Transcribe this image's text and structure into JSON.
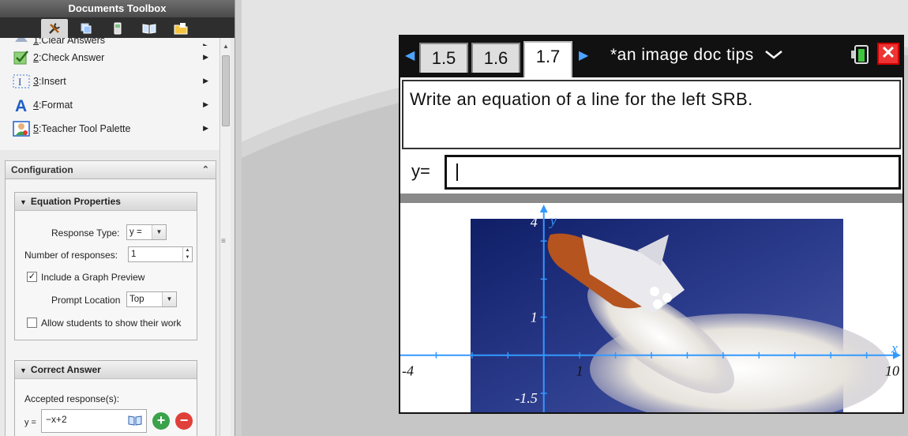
{
  "toolbox": {
    "title": "Documents Toolbox",
    "menu": [
      {
        "num": "1",
        "label": ":Clear Answers"
      },
      {
        "num": "2",
        "label": ":Check Answer"
      },
      {
        "num": "3",
        "label": ":Insert"
      },
      {
        "num": "4",
        "label": ":Format"
      },
      {
        "num": "5",
        "label": ":Teacher Tool Palette"
      }
    ],
    "config_title": "Configuration",
    "equation_properties": {
      "title": "Equation Properties",
      "response_type_label": "Response Type:",
      "response_type_value": "y =",
      "num_responses_label": "Number of responses:",
      "num_responses_value": "1",
      "include_graph_label": "Include a Graph Preview",
      "include_graph_checked": true,
      "prompt_location_label": "Prompt Location",
      "prompt_location_value": "Top",
      "allow_show_work_label": "Allow students to show their work",
      "allow_show_work_checked": false
    },
    "correct_answer": {
      "title": "Correct Answer",
      "accepted_label": "Accepted response(s):",
      "y_label": "y =",
      "value": "−x+2"
    }
  },
  "document": {
    "tabs": [
      "1.5",
      "1.6",
      "1.7"
    ],
    "active_tab": "1.7",
    "title": "*an image doc tips",
    "question": "Write an equation of a line for the left SRB.",
    "answer_label": "y=",
    "answer_value": ""
  },
  "graph": {
    "x_axis_label": "x",
    "y_axis_label": "y",
    "x_min_label": "-4",
    "x_max_label": "10",
    "x_tick_label": "1",
    "y_max_label": "4",
    "y_tick_label": "1",
    "y_min_label": "-1.5",
    "axis_color": "#3399ff"
  }
}
